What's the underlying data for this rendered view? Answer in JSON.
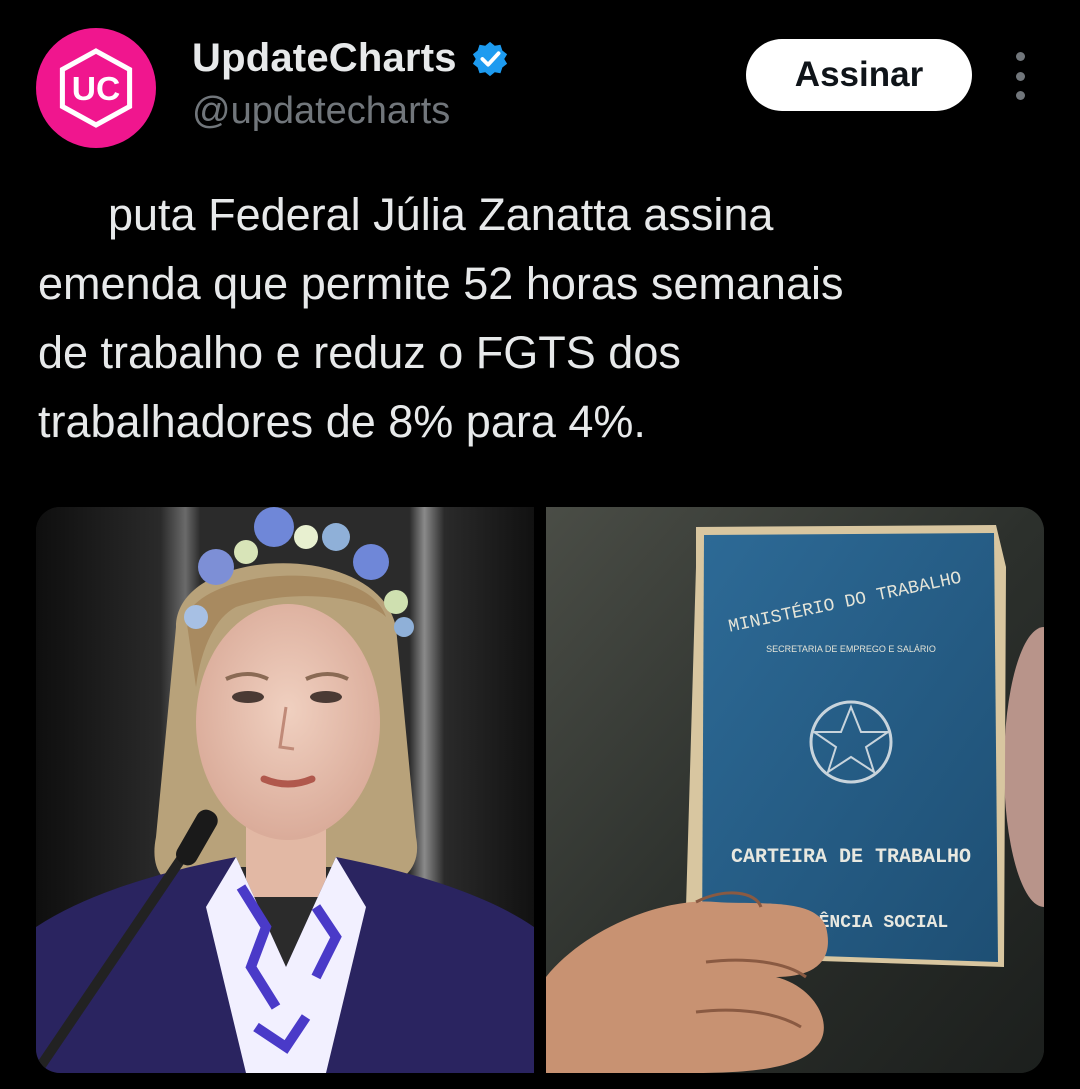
{
  "account": {
    "display_name": "UpdateCharts",
    "handle": "@updatecharts",
    "avatar_icon": "uc-logo-icon",
    "avatar_color": "#f0168e",
    "verified_icon": "verified-badge-icon",
    "verified_color": "#1d9bf0"
  },
  "actions": {
    "subscribe_label": "Assinar",
    "more_icon": "more-vertical-icon"
  },
  "tweet": {
    "lines": [
      "puta Federal Júlia Zanatta assina",
      "emenda que permite 52 horas semanais",
      "de trabalho e reduz o FGTS dos",
      "trabalhadores de 8% para 4%."
    ]
  },
  "media": {
    "photo_left": {
      "alt": "photo-of-woman-with-flower-crown-at-microphone"
    },
    "photo_right": {
      "booklet_top_text": "MINISTÉRIO DO TRABALHO",
      "booklet_sub_text": "SECRETARIA DE EMPREGO E SALÁRIO",
      "booklet_title_1": "CARTEIRA DE TRABALHO",
      "booklet_title_2": "PREVIDÊNCIA SOCIAL"
    }
  }
}
